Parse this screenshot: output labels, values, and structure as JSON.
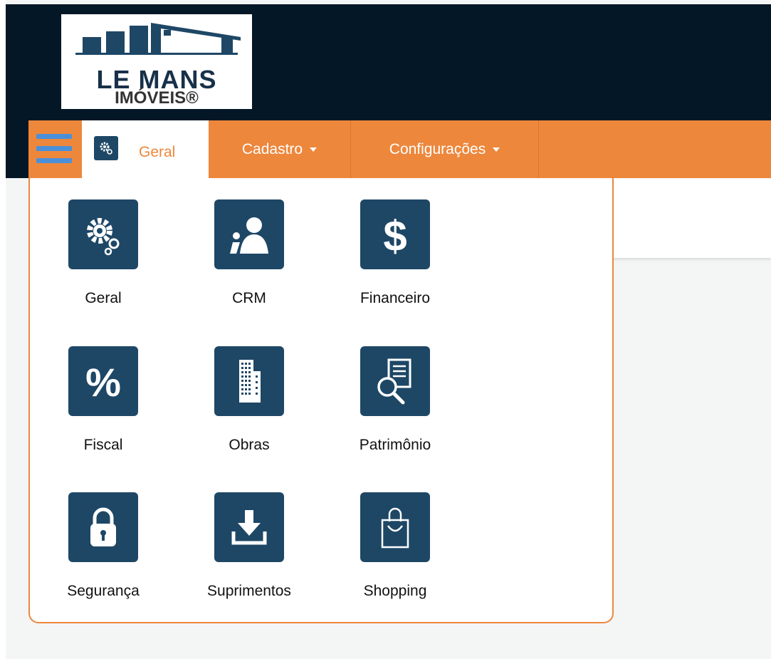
{
  "logo": {
    "line1": "LE MANS",
    "line2": "IMÓVEIS®"
  },
  "nav": {
    "menu_icon": "hamburger-menu-icon",
    "tabs": [
      {
        "label": "Geral",
        "icon": "gears-icon",
        "active": true
      },
      {
        "label": "Cadastro",
        "has_dropdown": true
      },
      {
        "label": "Configurações",
        "has_dropdown": true
      }
    ]
  },
  "dropdown": {
    "modules": [
      {
        "label": "Geral",
        "icon": "gears-icon"
      },
      {
        "label": "CRM",
        "icon": "people-icon"
      },
      {
        "label": "Financeiro",
        "icon": "dollar-icon"
      },
      {
        "label": "Fiscal",
        "icon": "percent-icon"
      },
      {
        "label": "Obras",
        "icon": "building-icon"
      },
      {
        "label": "Patrimônio",
        "icon": "document-search-icon"
      },
      {
        "label": "Segurança",
        "icon": "lock-icon"
      },
      {
        "label": "Suprimentos",
        "icon": "download-icon"
      },
      {
        "label": "Shopping",
        "icon": "shopping-bag-icon"
      }
    ]
  },
  "colors": {
    "header_bg": "#031726",
    "nav_orange": "#ed873c",
    "tile_blue": "#1e4766",
    "hamburger_blue": "#4a90d9"
  }
}
